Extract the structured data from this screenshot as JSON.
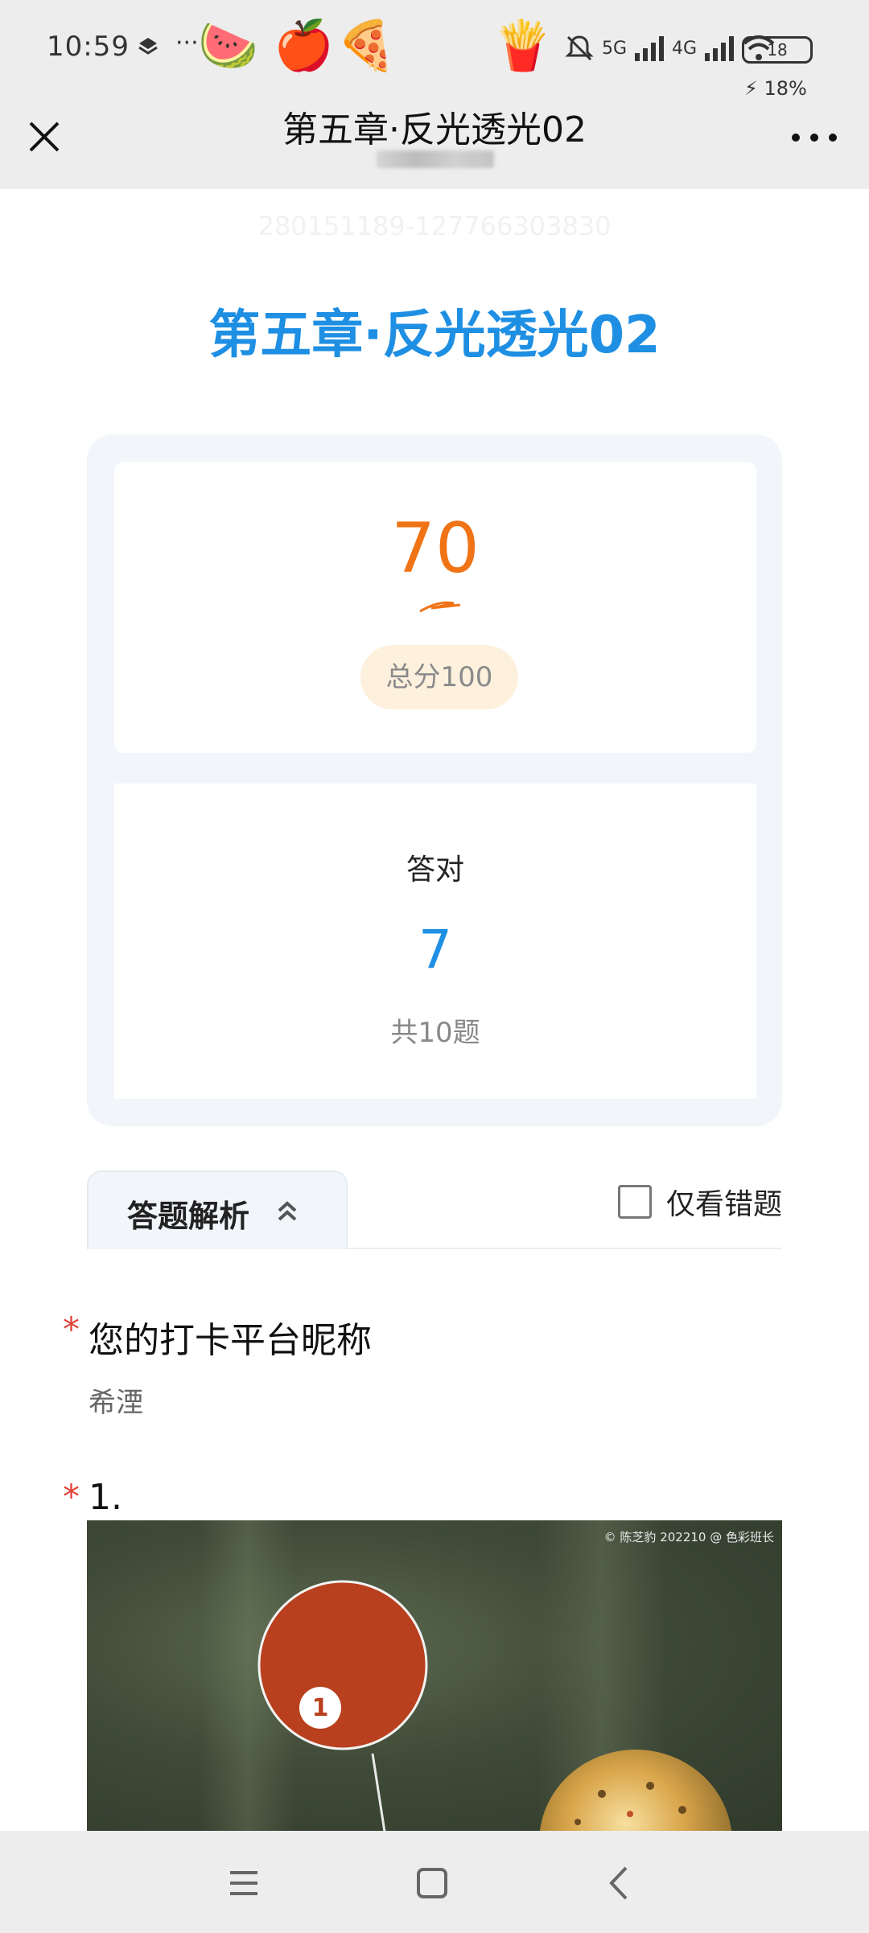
{
  "status_bar": {
    "time": "10:59",
    "dots": "···",
    "emoji": [
      "🍉",
      "🍎",
      "🍕",
      "🍟"
    ],
    "network_5g": "5G",
    "network_4g": "4G",
    "battery_level": "18",
    "battery_percent": "18%"
  },
  "nav": {
    "title": "第五章·反光透光02",
    "close_icon": "close-icon",
    "more_icon": "more-icon"
  },
  "page": {
    "faint_id": "280151189-127766303830",
    "title": "第五章·反光透光02"
  },
  "score": {
    "value": "70",
    "total_label": "总分100"
  },
  "correct": {
    "label": "答对",
    "value": "7",
    "total": "共10题"
  },
  "tabs": {
    "analysis_label": "答题解析",
    "only_wrong_label": "仅看错题"
  },
  "questions": [
    {
      "star": "*",
      "title": "您的打卡平台昵称",
      "answer": "希湮"
    },
    {
      "star": "*",
      "title": "1.",
      "image_caption": "© 陈芝豹 202210 @ 色彩班长",
      "marker_number": "1"
    }
  ],
  "colors": {
    "accent_blue": "#1e8fe3",
    "score_orange": "#f07316",
    "required_red": "#e0443a",
    "marker_red": "#b9401e"
  }
}
